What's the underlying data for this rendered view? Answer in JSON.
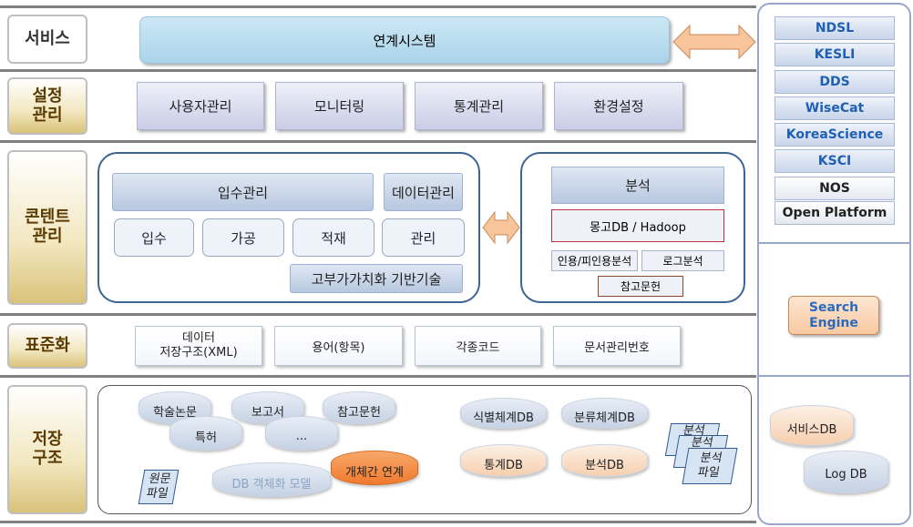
{
  "rows": {
    "service": "서비스",
    "settings": "설정\n관리",
    "content": "콘텐트\n관리",
    "standard": "표준화",
    "storage": "저장\n구조"
  },
  "service": {
    "linkage": "연계시스템"
  },
  "settings": [
    "사용자관리",
    "모니터링",
    "통계관리",
    "환경설정"
  ],
  "content": {
    "acquisition_mgmt": "입수관리",
    "data_mgmt": "데이터관리",
    "steps": [
      "입수",
      "가공",
      "적재",
      "관리"
    ],
    "high_value": "고부가가치화 기반기술",
    "analysis": {
      "title": "분석",
      "engine": "몽고DB / Hadoop",
      "citation": "인용/피인용분석",
      "log": "로그분석",
      "reference": "참고문헌"
    }
  },
  "standard": [
    "데이터\n저장구조(XML)",
    "용어(항목)",
    "각종코드",
    "문서관리번호"
  ],
  "storage": {
    "docs": [
      "학술논문",
      "보고서",
      "참고문헌",
      "특허",
      "..."
    ],
    "original_file": "원문\n파일",
    "db_model": "DB 객체화 모델",
    "inter_object": "개체간 연계",
    "dbs": [
      "식별체계DB",
      "분류체계DB",
      "통계DB",
      "분석DB"
    ],
    "analysis_files": [
      "분석",
      "분석",
      "분석\n파일"
    ]
  },
  "right": {
    "systems": [
      "NDSL",
      "KESLI",
      "DDS",
      "WiseCat",
      "KoreaScience",
      "KSCI",
      "NOS",
      "Open Platform"
    ],
    "search_engine": "Search\nEngine",
    "service_db": "서비스DB",
    "log_db": "Log DB"
  },
  "colors": {
    "accent_blue": "#3b6496",
    "orange": "#f08a3c",
    "link_bar": "#b7dcef"
  }
}
